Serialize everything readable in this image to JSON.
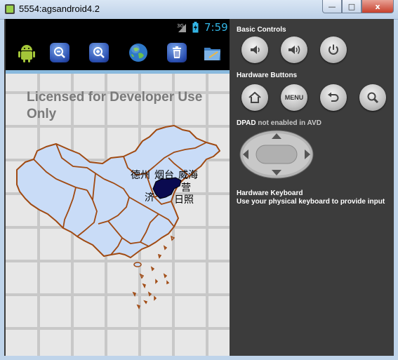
{
  "window": {
    "title": "5554:agsandroid4.2",
    "min": "—",
    "max": "□",
    "close": "x"
  },
  "status": {
    "network": "3G",
    "time": "7:59"
  },
  "toolbar": {
    "items": [
      {
        "name": "android-icon"
      },
      {
        "name": "zoom-out-icon"
      },
      {
        "name": "zoom-in-icon"
      },
      {
        "name": "globe-icon"
      },
      {
        "name": "trash-icon"
      },
      {
        "name": "folder-icon"
      }
    ]
  },
  "map": {
    "license": "Licensed for Developer Use Only",
    "labels": {
      "dezhou": "德州",
      "yantai": "烟台",
      "weihai": "威海",
      "dongying": "营",
      "jining": "济",
      "rizhao": "日照"
    },
    "colors": {
      "land": "#c9dcf7",
      "border": "#a04a12",
      "highlight": "#0a0a50",
      "grid": "#c8c8c8"
    }
  },
  "panel": {
    "basic_controls": "Basic Controls",
    "hardware_buttons": "Hardware Buttons",
    "dpad_title": "DPAD",
    "dpad_note": "not enabled in AVD",
    "menu_label": "MENU",
    "keyboard_title": "Hardware Keyboard",
    "keyboard_desc": "Use your physical keyboard to provide input"
  }
}
